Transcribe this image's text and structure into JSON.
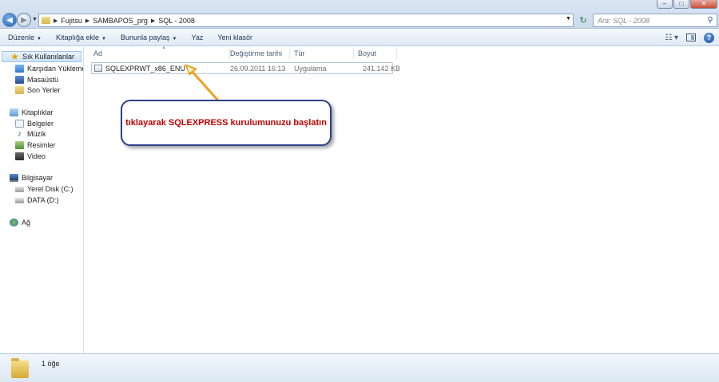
{
  "window": {
    "minimize_glyph": "–",
    "maximize_glyph": "□",
    "close_glyph": "✕"
  },
  "address_bar": {
    "breadcrumbs": [
      "Fujitsu",
      "SAMBAPOS_prg",
      "SQL - 2008"
    ],
    "search_placeholder": "Ara: SQL - 2008"
  },
  "toolbar": {
    "organize": "Düzenle",
    "include_in_library": "Kitaplığa ekle",
    "share_with": "Bununla paylaş",
    "burn": "Yaz",
    "new_folder": "Yeni klasör"
  },
  "nav": {
    "favorites": "Sık Kullanılanlar",
    "downloads": "Karşıdan Yüklemeler",
    "desktop": "Masaüstü",
    "recent": "Son Yerler",
    "libraries": "Kitaplıklar",
    "documents": "Belgeler",
    "music": "Müzik",
    "pictures": "Resimler",
    "videos": "Video",
    "computer": "Bilgisayar",
    "local_disk": "Yerel Disk (C:)",
    "data_disk": "DATA (D:)",
    "network": "Ağ"
  },
  "columns": {
    "name": "Ad",
    "date_modified": "Değiştirme tarihi",
    "type": "Tür",
    "size": "Boyut"
  },
  "files": [
    {
      "name": "SQLEXPRWT_x86_ENU",
      "date_modified": "26.09.2011 16:13",
      "type": "Uygulama",
      "size": "241.142 KB"
    }
  ],
  "callout": {
    "text": "tıklayarak SQLEXPRESS kurulumunuzu başlatın"
  },
  "details": {
    "item_count": "1 öğe"
  },
  "colors": {
    "callout_text": "#c00000",
    "callout_border": "#2c3f86",
    "arrow": "#f0a020"
  }
}
